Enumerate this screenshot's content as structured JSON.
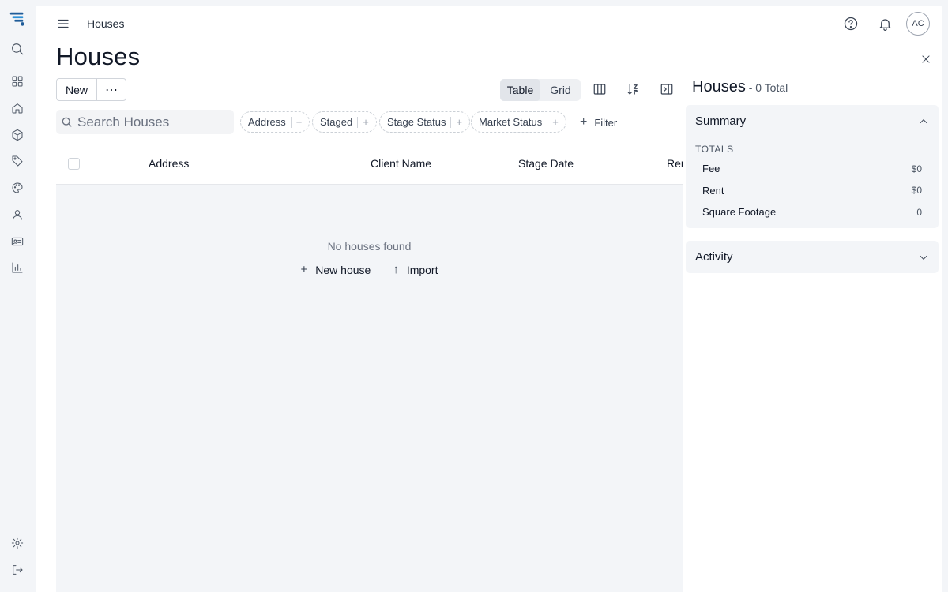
{
  "header": {
    "breadcrumb": "Houses",
    "title": "Houses",
    "avatar_initials": "AC"
  },
  "toolbar": {
    "new_label": "New",
    "more_label": "⋯",
    "view_options": [
      "Table",
      "Grid"
    ],
    "active_view": "Table"
  },
  "search": {
    "placeholder": "Search Houses"
  },
  "filters": {
    "chips": [
      "Address",
      "Staged",
      "Stage Status",
      "Market Status"
    ],
    "add_filter_label": "Filter"
  },
  "table": {
    "columns": [
      "Address",
      "Client Name",
      "Stage Date",
      "Ren"
    ],
    "empty_message": "No houses found",
    "new_house_label": "New house",
    "import_label": "Import"
  },
  "side_panel": {
    "title": "Houses",
    "count_text": " - 0 Total",
    "summary": {
      "title": "Summary",
      "totals_label": "TOTALS",
      "rows": [
        {
          "label": "Fee",
          "value": "$0"
        },
        {
          "label": "Rent",
          "value": "$0"
        },
        {
          "label": "Square Footage",
          "value": "0"
        }
      ]
    },
    "activity": {
      "title": "Activity"
    }
  },
  "colors": {
    "brand_primary": "#1f5c99",
    "brand_accent": "#2c8fd6"
  }
}
